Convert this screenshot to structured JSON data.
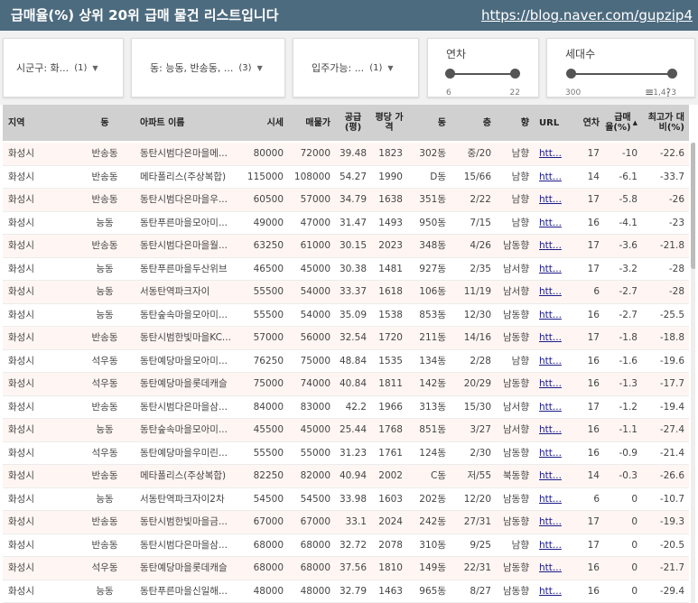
{
  "header": {
    "title": "급매율(%) 상위 20위 급매 물건 리스트입니다",
    "link": "https://blog.naver.com/gupzip4"
  },
  "filters": {
    "sigungu": {
      "label": "시군구: 화...",
      "count": "(1)"
    },
    "dong": {
      "label": "동: 능동, 반송동, ...",
      "count": "(3)"
    },
    "ipju": {
      "label": "입주가능: ...",
      "count": "(1)"
    },
    "year": {
      "label": "연차",
      "min": "6",
      "max": "22"
    },
    "households": {
      "label": "세대수",
      "min": "300",
      "max": "1,473"
    }
  },
  "table": {
    "columns": [
      "지역",
      "동",
      "아파트 이름",
      "시세",
      "매물가",
      "공급 (평)",
      "평당 가격",
      "동",
      "층",
      "향",
      "URL",
      "연차",
      "급매 율(%)",
      "최고가 대비(%)"
    ],
    "sort_indicator": "▲",
    "rows": [
      [
        "화성시",
        "반송동",
        "동탄시범다은마을메...",
        "80000",
        "72000",
        "39.48",
        "1823",
        "302동",
        "중/20",
        "남향",
        "htt...",
        "17",
        "-10",
        "-22.6"
      ],
      [
        "화성시",
        "반송동",
        "메타폴리스(주상복합)",
        "115000",
        "108000",
        "54.27",
        "1990",
        "D동",
        "15/66",
        "남향",
        "htt...",
        "14",
        "-6.1",
        "-33.7"
      ],
      [
        "화성시",
        "반송동",
        "동탄시범다은마을우...",
        "60500",
        "57000",
        "34.79",
        "1638",
        "351동",
        "2/22",
        "남향",
        "htt...",
        "17",
        "-5.8",
        "-26"
      ],
      [
        "화성시",
        "능동",
        "동탄푸른마을모아미...",
        "49000",
        "47000",
        "31.47",
        "1493",
        "950동",
        "7/15",
        "남향",
        "htt...",
        "16",
        "-4.1",
        "-23"
      ],
      [
        "화성시",
        "반송동",
        "동탄시범다은마을월...",
        "63250",
        "61000",
        "30.15",
        "2023",
        "348동",
        "4/26",
        "남동향",
        "htt...",
        "17",
        "-3.6",
        "-21.8"
      ],
      [
        "화성시",
        "능동",
        "동탄푸른마을두산위브",
        "46500",
        "45000",
        "30.38",
        "1481",
        "927동",
        "2/35",
        "남서향",
        "htt...",
        "17",
        "-3.2",
        "-28"
      ],
      [
        "화성시",
        "능동",
        "서동탄역파크자이",
        "55500",
        "54000",
        "33.37",
        "1618",
        "106동",
        "11/19",
        "남서향",
        "htt...",
        "6",
        "-2.7",
        "-28"
      ],
      [
        "화성시",
        "능동",
        "동탄숲속마을모아미...",
        "55500",
        "54000",
        "35.09",
        "1538",
        "853동",
        "12/30",
        "남동향",
        "htt...",
        "16",
        "-2.7",
        "-25.5"
      ],
      [
        "화성시",
        "반송동",
        "동탄시범한빛마을KC...",
        "57000",
        "56000",
        "32.54",
        "1720",
        "211동",
        "14/16",
        "남동향",
        "htt...",
        "17",
        "-1.8",
        "-18.8"
      ],
      [
        "화성시",
        "석우동",
        "동탄예당마을모아미...",
        "76250",
        "75000",
        "48.84",
        "1535",
        "134동",
        "2/28",
        "남향",
        "htt...",
        "16",
        "-1.6",
        "-19.6"
      ],
      [
        "화성시",
        "석우동",
        "동탄예당마을롯데캐슬",
        "75000",
        "74000",
        "40.84",
        "1811",
        "142동",
        "20/29",
        "남동향",
        "htt...",
        "16",
        "-1.3",
        "-17.7"
      ],
      [
        "화성시",
        "반송동",
        "동탄시범다은마을삼...",
        "84000",
        "83000",
        "42.2",
        "1966",
        "313동",
        "15/30",
        "남서향",
        "htt...",
        "17",
        "-1.2",
        "-19.4"
      ],
      [
        "화성시",
        "능동",
        "동탄숲속마을모아미...",
        "45500",
        "45000",
        "25.44",
        "1768",
        "851동",
        "3/27",
        "남서향",
        "htt...",
        "16",
        "-1.1",
        "-27.4"
      ],
      [
        "화성시",
        "석우동",
        "동탄예당마을우미린...",
        "55500",
        "55000",
        "31.23",
        "1761",
        "124동",
        "2/30",
        "남동향",
        "htt...",
        "16",
        "-0.9",
        "-21.4"
      ],
      [
        "화성시",
        "반송동",
        "메타폴리스(주상복합)",
        "82250",
        "82000",
        "40.94",
        "2002",
        "C동",
        "저/55",
        "북동향",
        "htt...",
        "14",
        "-0.3",
        "-26.6"
      ],
      [
        "화성시",
        "능동",
        "서동탄역파크자이2차",
        "54500",
        "54500",
        "33.98",
        "1603",
        "202동",
        "12/20",
        "남동향",
        "htt...",
        "6",
        "0",
        "-10.7"
      ],
      [
        "화성시",
        "반송동",
        "동탄시범한빛마을금...",
        "67000",
        "67000",
        "33.1",
        "2024",
        "242동",
        "27/31",
        "남동향",
        "htt...",
        "17",
        "0",
        "-19.3"
      ],
      [
        "화성시",
        "반송동",
        "동탄시범다은마을삼...",
        "68000",
        "68000",
        "32.72",
        "2078",
        "310동",
        "9/25",
        "남향",
        "htt...",
        "17",
        "0",
        "-20.5"
      ],
      [
        "화성시",
        "석우동",
        "동탄예당마을롯데캐슬",
        "68000",
        "68000",
        "37.56",
        "1810",
        "149동",
        "22/31",
        "남동향",
        "htt...",
        "16",
        "0",
        "-21.7"
      ],
      [
        "화성시",
        "능동",
        "동탄푸른마을신일해...",
        "48000",
        "48000",
        "32.79",
        "1463",
        "965동",
        "8/27",
        "남동향",
        "htt...",
        "16",
        "0",
        "-29.4"
      ]
    ]
  }
}
